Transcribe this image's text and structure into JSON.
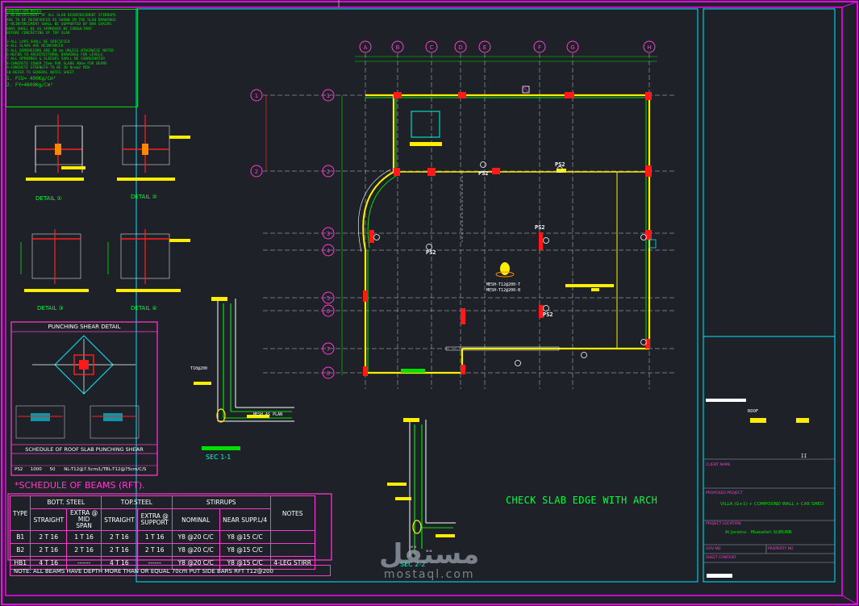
{
  "general_notes": {
    "title": "GENERATION NOTES",
    "lines": [
      "1-REINFORCEMENT OF ALL SLAB REINFORCEMENT STIRRUPS",
      "ARE TO BE REINFORCED AS SHOWN IN THE SLAB DRAWINGS",
      "2-REINFORCEMENT SHALL BE SUPPORTED BY BAR CHAIRS",
      "BARS SHALL BE AS APPROVED BY CONSULTANT",
      "BEFORE CONCRETING OF TOP SLAB",
      "",
      "3-ALL LAPS SHALL BE SPECIFIED",
      "4-ALL SLABS ARE REINFORCED",
      "5-ALL DIMENSIONS ARE IN mm UNLESS OTHERWISE NOTED",
      "6-REFER TO ARCHITECTURAL DRAWINGS FOR LEVELS",
      "7-ALL OPENINGS & SLEEVES SHALL BE COORDINATED",
      "8-CONCRETE COVER 25mm FOR SLABS 40mm FOR BEAMS",
      "9-CONCRETE STRENGTH TO BE 30 N/mm2 MIN",
      "10-REFER TO GENERAL NOTES SHEET"
    ],
    "fcu": "1.   FCU= 400Kg/Cm²",
    "fy": "2.   FY=4600Kg/Cm²"
  },
  "grid": {
    "columns": [
      "A",
      "B",
      "C",
      "D",
      "E",
      "F",
      "G",
      "H"
    ],
    "rows": [
      "1",
      "2",
      "3",
      "4",
      "5",
      "6",
      "7",
      "8"
    ]
  },
  "plan_labels": {
    "ps2": "PS2",
    "mesh1": "MESH-T12@200-T",
    "mesh2": "MESH-T12@200-B"
  },
  "details": {
    "a": "DETAIL ①",
    "b": "DETAIL ②",
    "c": "DETAIL ③",
    "d": "DETAIL ④"
  },
  "punching": {
    "title": "PUNCHING SHEAR DETAIL",
    "schedule_title": "SCHEDULE OF ROOF SLAB PUNCHING SHEAR",
    "row": [
      "PS2",
      "1000",
      "50",
      "NL-T12@7.5cm/L/TBL-T12@75cm/C/S"
    ]
  },
  "sections": {
    "sec1": "SEC 1-1",
    "sec2": "SEC 2-2",
    "mesh_note": "MESH AS PLAN",
    "t10": "T10@200"
  },
  "beams_schedule": {
    "title": "*SCHEDULE OF BEAMS (RFT).",
    "headers": {
      "type": "TYPE",
      "bott": "BOTT. STEEL",
      "top": "TOP.STEEL",
      "stirrups": "STIRRUPS",
      "notes": "NOTES",
      "straight": "STRAIGHT",
      "extra_mid": "EXTRA @ MID SPAN",
      "straight2": "STRAIGHT",
      "extra_sup": "EXTRA @ SUPPORT",
      "nominal": "NOMINAL",
      "near": "NEAR SUPP.L/4"
    },
    "rows": [
      {
        "type": "B1",
        "bs": "2 T 16",
        "bm": "1 T 16",
        "ts": "2 T 16",
        "tx": "1 T 16",
        "nom": "Y8 @20 C/C",
        "near": "Y8 @15 C/C",
        "note": ""
      },
      {
        "type": "B2",
        "bs": "2 T 16",
        "bm": "2 T 16",
        "ts": "2 T 16",
        "tx": "2 T 16",
        "nom": "Y8 @20 C/C",
        "near": "Y8 @15 C/C",
        "note": ""
      },
      {
        "type": "HB1",
        "bs": "4 T 16",
        "bm": "------",
        "ts": "4 T 16",
        "tx": "------",
        "nom": "Y8 @20 C/C",
        "near": "Y8 @15 C/C",
        "note": "4-LEG STIRR"
      }
    ],
    "footnote": "NOTE: ALL BEAMS HAVE DEPTH MORE THAN OR EQUAL 70cm PUT SIDE BARS RFT T12@200"
  },
  "main_title": "CHECK SLAB EDGE WITH ARCH",
  "title_block": {
    "sheet_name": "ROOF",
    "client_name_label": "CLIENT NAME",
    "proposed_label": "PROPOSED PROJECT",
    "proposed_value": "VILLA (G+1) + COMPOUND WALL + CAR SHED",
    "location_label": "PROJECT LOCATION",
    "location_value": "Al Jurainu - Muwaileh SUBURB",
    "gov_label": "GOV NO",
    "property_label": "PROPERTY NO",
    "sheet_content_label": "SHEET CONTENT",
    "rev_mark": "II"
  },
  "watermark": {
    "arabic": "مستقل",
    "latin": "mostaql.com"
  },
  "colors": {
    "background": "#1e2228",
    "frame": "#ff00ff",
    "border_cyan": "#00e5ff",
    "text_green": "#00ff40",
    "beam_red": "#ff1a1a",
    "yellow": "#ffee00"
  }
}
